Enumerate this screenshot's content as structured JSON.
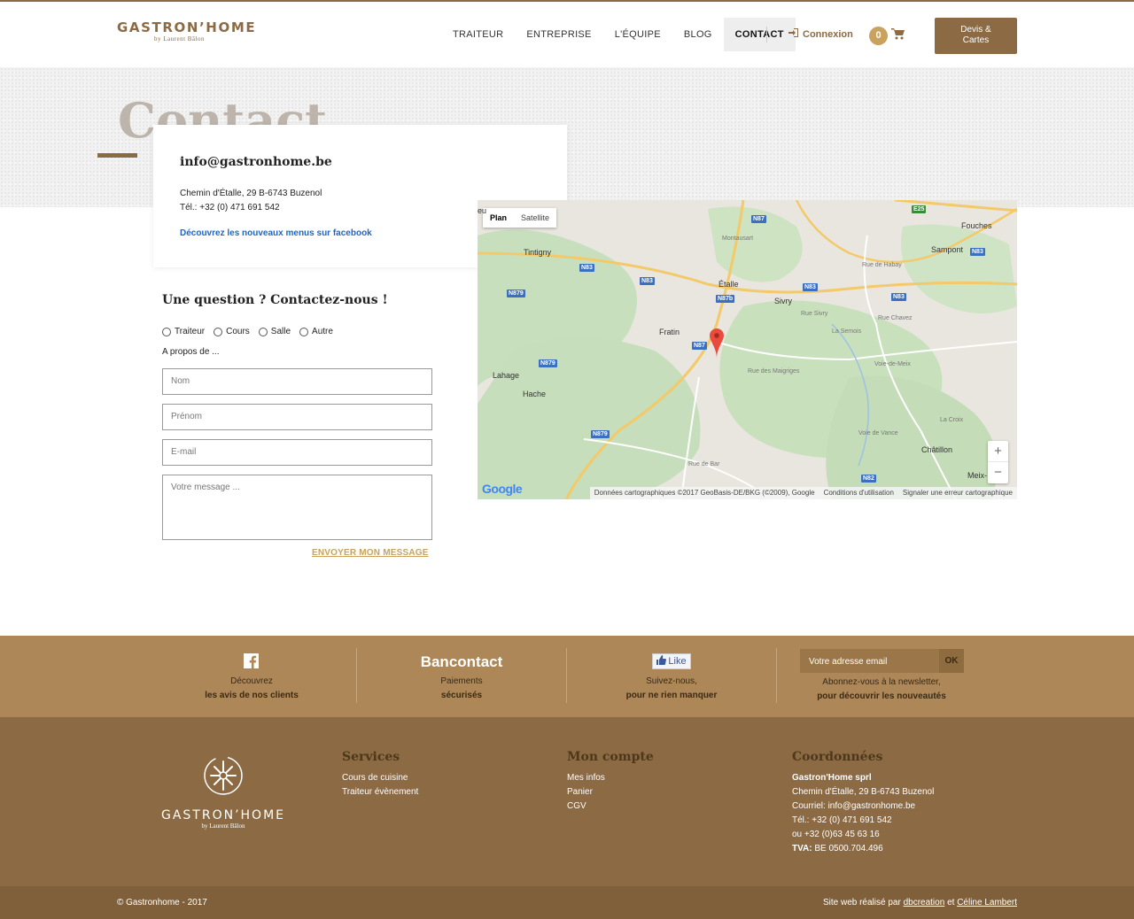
{
  "header": {
    "logo_name": "GASTRON’HOME",
    "logo_sub": "by Laurent Bâlon",
    "nav": [
      "TRAITEUR",
      "ENTREPRISE",
      "L'ÉQUIPE",
      "BLOG",
      "CONTACT"
    ],
    "active_nav": "CONTACT",
    "login_label": "Connexion",
    "cart_count": "0",
    "devis_line1": "Devis &",
    "devis_line2": "Cartes"
  },
  "page": {
    "title": "Contact"
  },
  "info": {
    "email": "info@gastronhome.be",
    "address": "Chemin d'Étalle, 29 B-6743 Buzenol",
    "phone": "Tél.: +32 (0) 471 691 542",
    "facebook_link": "Découvrez les nouveaux menus sur facebook"
  },
  "form": {
    "title": "Une question ? Contactez-nous !",
    "options": [
      "Traiteur",
      "Cours",
      "Salle",
      "Autre"
    ],
    "about_label": "A propos de ...",
    "name_placeholder": "Nom",
    "firstname_placeholder": "Prénom",
    "email_placeholder": "E-mail",
    "message_placeholder": "Votre message ...",
    "send_label": "ENVOYER MON MESSAGE"
  },
  "map": {
    "tab_plan": "Plan",
    "tab_satellite": "Satellite",
    "places": [
      "Fouches",
      "Sampont",
      "Tintigny",
      "Étalle",
      "Sivry",
      "Fratin",
      "Lahage",
      "Hache",
      "Châtillon",
      "Meix-",
      "eu"
    ],
    "roads": [
      "N87",
      "E25",
      "N83",
      "N83",
      "N83",
      "N879",
      "N87b",
      "N83",
      "N83",
      "N87",
      "N879",
      "N879",
      "N82"
    ],
    "streets": [
      "Rue des Maigriges",
      "Voie-de-Meix",
      "La Semois",
      "Rue Sivry",
      "Rue Chavez",
      "Rue de Habay",
      "Montausart",
      "Voie de Vance",
      "La Croix",
      "Rue de Bar"
    ],
    "zoom_in": "+",
    "zoom_out": "−",
    "google": "Google",
    "attribution": "Données cartographiques ©2017 GeoBasis-DE/BKG (©2009), Google",
    "terms": "Conditions d'utilisation",
    "report": "Signaler une erreur cartographique"
  },
  "band": {
    "facebook_l1": "Découvrez",
    "facebook_l2": "les avis de nos clients",
    "bancontact_title": "Bancontact",
    "bancontact_l1": "Paiements",
    "bancontact_l2": "sécurisés",
    "like_label": "Like",
    "like_l1": "Suivez-nous,",
    "like_l2": "pour ne rien manquer",
    "newsletter_placeholder": "Votre adresse email",
    "ok_label": "OK",
    "newsletter_l1": "Abonnez-vous à la newsletter,",
    "newsletter_l2": "pour découvrir les nouveautés"
  },
  "footer": {
    "logo_name": "GASTRON’HOME",
    "logo_sub": "by Laurent Bâlon",
    "services_title": "Services",
    "services": [
      "Cours de cuisine",
      "Traiteur évènement"
    ],
    "account_title": "Mon compte",
    "account": [
      "Mes infos",
      "Panier",
      "CGV"
    ],
    "contact_title": "Coordonnées",
    "company": "Gastron'Home sprl",
    "address": "Chemin d'Étalle, 29 B-6743 Buzenol",
    "email_line": "Courriel: info@gastronhome.be",
    "phone1": "Tél.: +32 (0) 471 691 542",
    "phone2": "ou +32 (0)63 45 63 16",
    "tva_label": "TVA:",
    "tva_value": "BE 0500.704.496",
    "copyright": "© Gastronhome - 2017",
    "credits_prefix": "Site web réalisé par",
    "credits_a": "dbcreation",
    "credits_and": "et",
    "credits_b": "Céline Lambert"
  },
  "colors": {
    "brand": "#8b6a44",
    "gold": "#c9a25e",
    "band": "#ad8758",
    "link": "#1a66cc"
  }
}
